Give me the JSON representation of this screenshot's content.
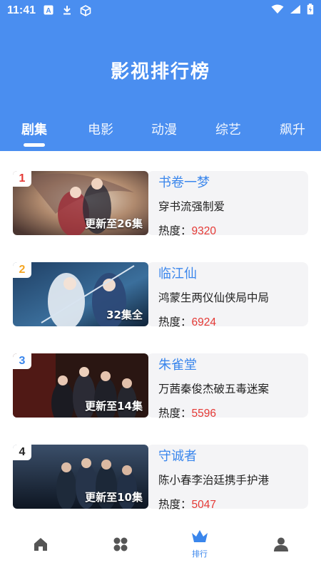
{
  "status_bar": {
    "time": "11:41",
    "icons_left": [
      "a-icon",
      "download-icon",
      "box-icon"
    ],
    "icons_right": [
      "wifi-icon",
      "signal-icon",
      "battery-icon"
    ]
  },
  "header": {
    "title": "影视排行榜"
  },
  "tabs": [
    {
      "label": "剧集",
      "active": true
    },
    {
      "label": "电影",
      "active": false
    },
    {
      "label": "动漫",
      "active": false
    },
    {
      "label": "综艺",
      "active": false
    },
    {
      "label": "飙升",
      "active": false
    }
  ],
  "items": [
    {
      "rank": "1",
      "rank_color": "#e53935",
      "title": "书卷一梦",
      "desc": "穿书流强制爱",
      "heat_label": "热度：",
      "heat": "9320",
      "badge": "更新至26集"
    },
    {
      "rank": "2",
      "rank_color": "#f5a623",
      "title": "临江仙",
      "desc": "鸿蒙生两仪仙侠局中局",
      "heat_label": "热度：",
      "heat": "6924",
      "badge": "32集全"
    },
    {
      "rank": "3",
      "rank_color": "#3a86ec",
      "title": "朱雀堂",
      "desc": "万茜秦俊杰破五毒迷案",
      "heat_label": "热度：",
      "heat": "5596",
      "badge": "更新至14集"
    },
    {
      "rank": "4",
      "rank_color": "#222222",
      "title": "守诚者",
      "desc": "陈小春李治廷携手护港",
      "heat_label": "热度：",
      "heat": "5047",
      "badge": "更新至10集"
    }
  ],
  "bottom_nav": [
    {
      "icon": "home-icon",
      "label": ""
    },
    {
      "icon": "apps-icon",
      "label": ""
    },
    {
      "icon": "crown-icon",
      "label": "排行",
      "active": true
    },
    {
      "icon": "person-icon",
      "label": ""
    }
  ],
  "colors": {
    "primary": "#4a8ef0",
    "accent": "#3a86ec",
    "heat": "#e53935"
  }
}
